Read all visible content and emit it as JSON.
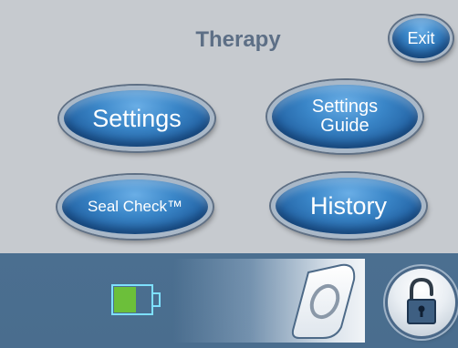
{
  "header": {
    "title": "Therapy",
    "exit_label": "Exit"
  },
  "menu": {
    "settings_label": "Settings",
    "settings_guide_label": "Settings\nGuide",
    "seal_check_label": "Seal Check™",
    "history_label": "History"
  },
  "status_bar": {
    "battery_level": 0.6,
    "icons": [
      "battery-icon",
      "slide-to-unlock-handle-icon",
      "unlock-icon"
    ]
  },
  "colors": {
    "background": "#c6cacf",
    "title": "#5d6f86",
    "button_blue": "#2565a6",
    "status_bar": "#4b6f90",
    "battery_fill": "#6cbf3a"
  }
}
